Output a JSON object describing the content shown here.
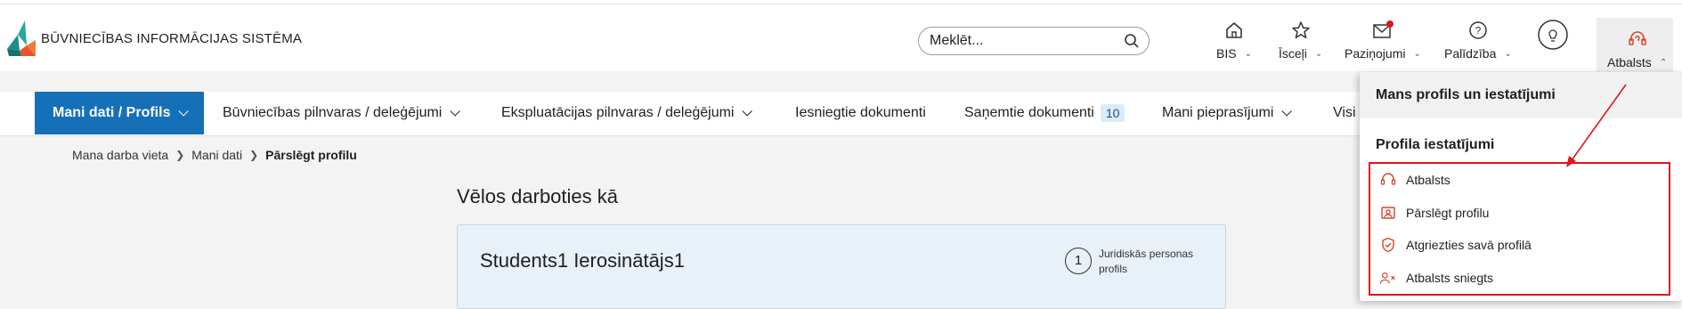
{
  "header": {
    "logo_text": "BŪVNIECĪBAS INFORMĀCIJAS SISTĒMA",
    "search_placeholder": "Meklēt...",
    "items": [
      {
        "label": "BIS"
      },
      {
        "label": "Īsceļi"
      },
      {
        "label": "Paziņojumi"
      },
      {
        "label": "Palīdzība"
      },
      {
        "label": ""
      },
      {
        "label": "Atbalsts"
      }
    ]
  },
  "nav": {
    "items": [
      {
        "label": "Mani dati / Profils"
      },
      {
        "label": "Būvniecības pilnvaras / deleģējumi"
      },
      {
        "label": "Ekspluatācijas pilnvaras / deleģējumi"
      },
      {
        "label": "Iesniegtie dokumenti"
      },
      {
        "label": "Saņemtie dokumenti",
        "badge": "10"
      },
      {
        "label": "Mani pieprasījumi"
      },
      {
        "label": "Visi"
      }
    ]
  },
  "breadcrumb": [
    "Mana darba vieta",
    "Mani dati",
    "Pārslēgt profilu"
  ],
  "main": {
    "title": "Vēlos darboties kā",
    "card": {
      "name": "Students1 Ierosinātājs1",
      "count": "1",
      "profile_type": "Juridiskās personas profils"
    }
  },
  "dropdown": {
    "title": "Mans profils un iestatījumi",
    "section": "Profila iestatījumi",
    "items": [
      {
        "label": "Atbalsts",
        "icon": "headset-icon"
      },
      {
        "label": "Pārslēgt profilu",
        "icon": "profile-card-icon"
      },
      {
        "label": "Atgriezties savā profilā",
        "icon": "shield-check-icon"
      },
      {
        "label": "Atbalsts sniegts",
        "icon": "user-x-icon"
      }
    ]
  },
  "colors": {
    "accent": "#1570b8",
    "highlight": "#e0141c",
    "notification_dot": "#e0141c",
    "dropdown_icons": "#d2462c"
  }
}
